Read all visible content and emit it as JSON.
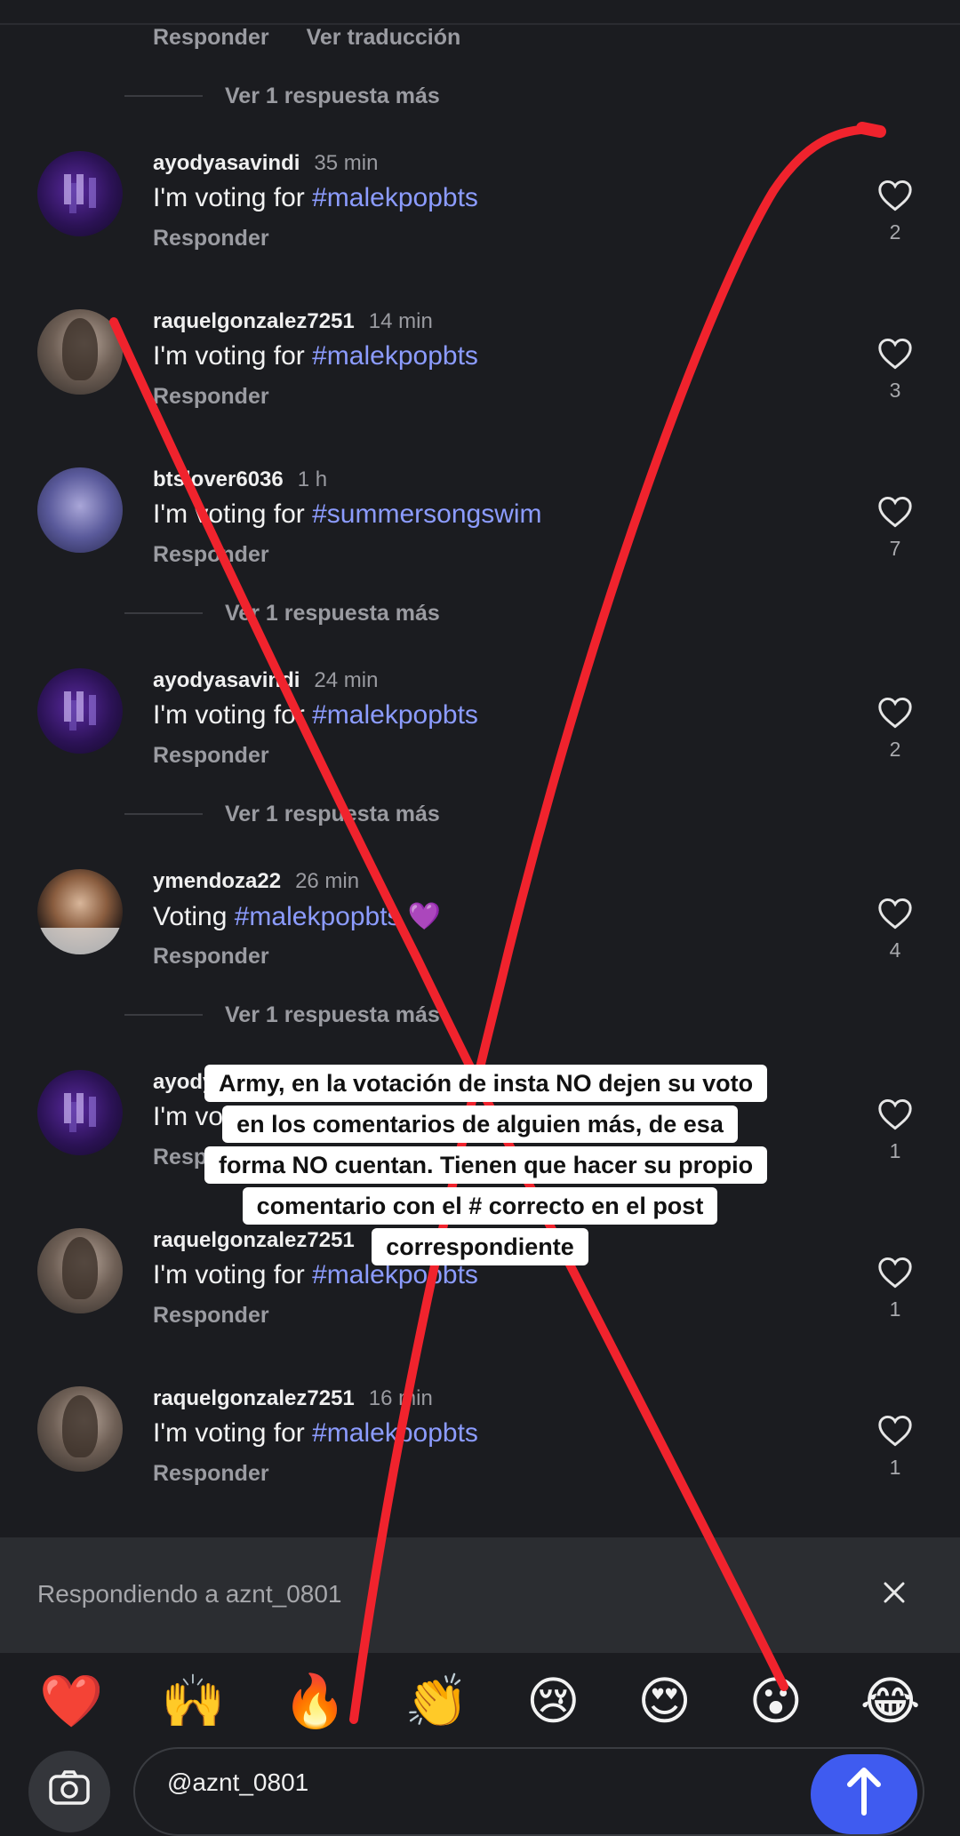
{
  "top_actions": {
    "reply": "Responder",
    "translate": "Ver traducción"
  },
  "more_replies_label": "Ver 1 respuesta más",
  "reply_label": "Responder",
  "comments": [
    {
      "user": "ayodyasavindi",
      "time": "35 min",
      "text": "I'm voting for ",
      "tag": "#malekpopbts",
      "likes": "2"
    },
    {
      "user": "raquelgonzalez7251",
      "time": "14 min",
      "text": "I'm voting for ",
      "tag": "#malekpopbts",
      "likes": "3"
    },
    {
      "user": "btslover6036",
      "time": "1 h",
      "text": "I'm voting for ",
      "tag": "#summersongswim",
      "likes": "7"
    },
    {
      "user": "ayodyasavindi",
      "time": "24 min",
      "text": "I'm voting for ",
      "tag": "#malekpopbts",
      "likes": "2"
    },
    {
      "user": "ymendoza22",
      "time": "26 min",
      "text": "Voting ",
      "tag": "#malekpopbts 💜",
      "likes": "4"
    },
    {
      "user": "ayodyasavindi",
      "time": "",
      "text": "I'm voting for ",
      "tag": "",
      "likes": "1"
    },
    {
      "user": "raquelgonzalez7251",
      "time": "",
      "text": "I'm voting for ",
      "tag": "#malekpopbts",
      "likes": "1"
    },
    {
      "user": "raquelgonzalez7251",
      "time": "16 min",
      "text": "I'm voting for ",
      "tag": "#malekpopbts",
      "likes": "1"
    }
  ],
  "replying_to": "Respondiendo a aznt_0801",
  "emojis": [
    "❤️",
    "🙌",
    "🔥",
    "👏",
    "😢",
    "😍",
    "😮",
    "😂"
  ],
  "input_value": "@aznt_0801",
  "overlay_caption": "Army, en la votación de insta NO dejen su voto en los comentarios de alguien más, de esa forma NO cuentan. Tienen que hacer su propio comentario con el # correcto en el post correspondiente",
  "colors": {
    "background": "#1b1c20",
    "hashtag": "#8c9cff",
    "send_button": "#3f5bf0",
    "red_mark": "#f0232d"
  }
}
